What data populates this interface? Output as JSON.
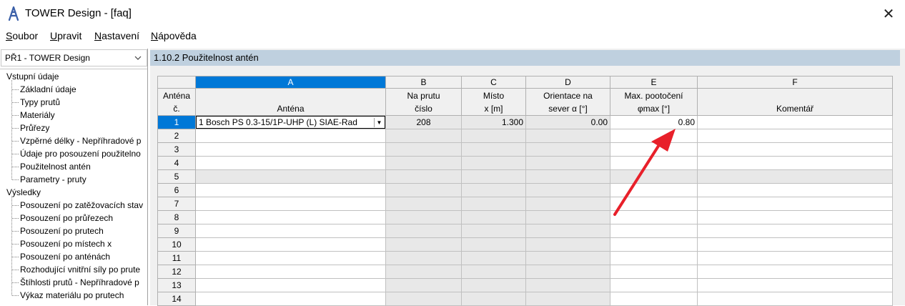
{
  "window": {
    "title": "TOWER Design - [faq]",
    "close_glyph": "✕"
  },
  "menu": [
    {
      "label": "Soubor"
    },
    {
      "label": "Upravit"
    },
    {
      "label": "Nastavení"
    },
    {
      "label": "Nápověda"
    }
  ],
  "navigator": {
    "combo_value": "PŘ1 - TOWER Design",
    "sections": [
      {
        "label": "Vstupní údaje",
        "items": [
          "Základní údaje",
          "Typy prutů",
          "Materiály",
          "Průřezy",
          "Vzpěrné délky - Nepříhradové p",
          "Údaje pro posouzení použitelno",
          "Použitelnost antén",
          "Parametry - pruty"
        ]
      },
      {
        "label": "Výsledky",
        "items": [
          "Posouzení po zatěžovacích stav",
          "Posouzení po průřezech",
          "Posouzení po prutech",
          "Posouzení po místech x",
          "Posouzení po anténách",
          "Rozhodující vnitřní síly po prute",
          "Štíhlosti prutů - Nepříhradové p",
          "Výkaz materiálu po prutech"
        ]
      }
    ]
  },
  "panel": {
    "title": "1.10.2 Použitelnost antén"
  },
  "table": {
    "column_letters": [
      "A",
      "B",
      "C",
      "D",
      "E",
      "F"
    ],
    "header_row_label": [
      "Anténa",
      "č."
    ],
    "headers": [
      [
        "",
        "Anténa"
      ],
      [
        "Na prutu",
        "číslo"
      ],
      [
        "Místo",
        "x [m]"
      ],
      [
        "Orientace na",
        "sever α [°]"
      ],
      [
        "Max. pootočení",
        "φmax [°]"
      ],
      [
        "",
        "Komentář"
      ]
    ],
    "rows": [
      {
        "num": "1",
        "antenna": "1 Bosch PS 0.3-15/1P-UHP (L) SIAE-Rad",
        "member": "208",
        "x": "1.300",
        "orientation": "0.00",
        "max_rotation": "0.80",
        "comment": ""
      },
      {
        "num": "2",
        "antenna": "",
        "member": "",
        "x": "",
        "orientation": "",
        "max_rotation": "",
        "comment": ""
      },
      {
        "num": "3",
        "antenna": "",
        "member": "",
        "x": "",
        "orientation": "",
        "max_rotation": "",
        "comment": ""
      },
      {
        "num": "4",
        "antenna": "",
        "member": "",
        "x": "",
        "orientation": "",
        "max_rotation": "",
        "comment": ""
      },
      {
        "num": "5",
        "antenna": "",
        "member": "",
        "x": "",
        "orientation": "",
        "max_rotation": "",
        "comment": ""
      },
      {
        "num": "6",
        "antenna": "",
        "member": "",
        "x": "",
        "orientation": "",
        "max_rotation": "",
        "comment": ""
      },
      {
        "num": "7",
        "antenna": "",
        "member": "",
        "x": "",
        "orientation": "",
        "max_rotation": "",
        "comment": ""
      },
      {
        "num": "8",
        "antenna": "",
        "member": "",
        "x": "",
        "orientation": "",
        "max_rotation": "",
        "comment": ""
      },
      {
        "num": "9",
        "antenna": "",
        "member": "",
        "x": "",
        "orientation": "",
        "max_rotation": "",
        "comment": ""
      },
      {
        "num": "10",
        "antenna": "",
        "member": "",
        "x": "",
        "orientation": "",
        "max_rotation": "",
        "comment": ""
      },
      {
        "num": "11",
        "antenna": "",
        "member": "",
        "x": "",
        "orientation": "",
        "max_rotation": "",
        "comment": ""
      },
      {
        "num": "12",
        "antenna": "",
        "member": "",
        "x": "",
        "orientation": "",
        "max_rotation": "",
        "comment": ""
      },
      {
        "num": "13",
        "antenna": "",
        "member": "",
        "x": "",
        "orientation": "",
        "max_rotation": "",
        "comment": ""
      },
      {
        "num": "14",
        "antenna": "",
        "member": "",
        "x": "",
        "orientation": "",
        "max_rotation": "",
        "comment": ""
      }
    ]
  },
  "colors": {
    "selection_blue": "#0078d7",
    "panel_title_bg": "#bfd0df",
    "annotation_arrow": "#e8202a"
  },
  "icons": {
    "app": "tower-icon",
    "dropdown": "chevron-down-icon",
    "cell_dropdown": "triangle-down-icon"
  }
}
